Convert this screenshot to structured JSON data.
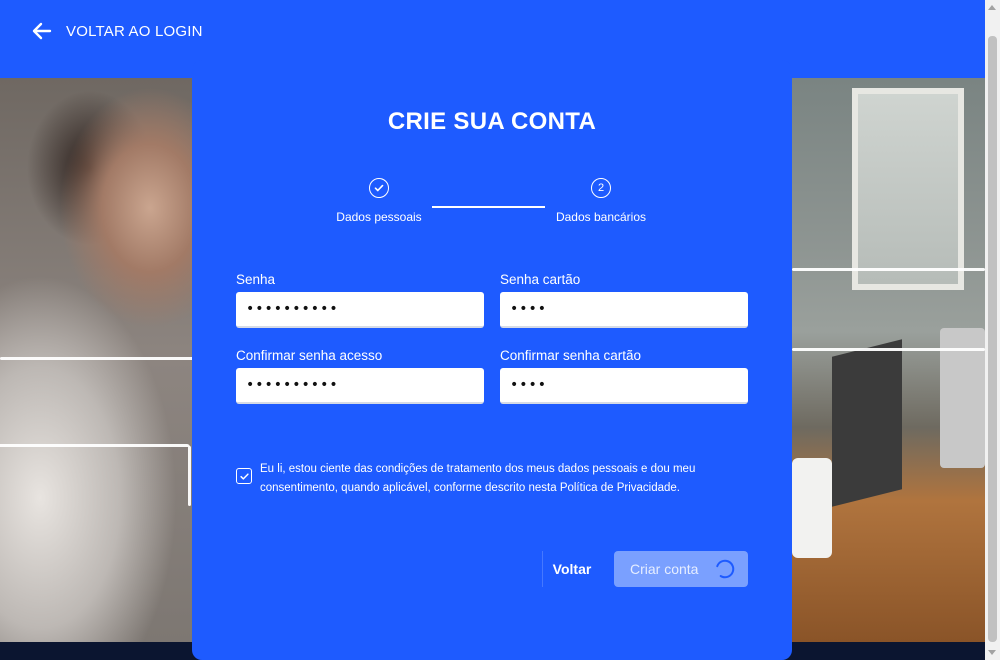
{
  "header": {
    "back_label": "VOLTAR AO LOGIN"
  },
  "card": {
    "title": "CRIE SUA CONTA",
    "steps": [
      {
        "label": "Dados pessoais",
        "state": "done",
        "icon": "check-icon"
      },
      {
        "label": "Dados bancários",
        "state": "current",
        "number": "2"
      }
    ],
    "fields": {
      "senha": {
        "label": "Senha",
        "value": "••••••••••"
      },
      "senha_cartao": {
        "label": "Senha cartão",
        "value": "••••"
      },
      "confirmar_senha_acesso": {
        "label": "Confirmar senha acesso",
        "value": "••••••••••"
      },
      "confirmar_senha_cartao": {
        "label": "Confirmar senha cartão",
        "value": "••••"
      }
    },
    "consent": {
      "checked": true,
      "text": "Eu li, estou ciente das condições de tratamento dos meus dados pessoais e dou meu consentimento, quando aplicável, conforme descrito nesta Política de Privacidade."
    },
    "buttons": {
      "back_label": "Voltar",
      "create_label": "Criar conta"
    }
  },
  "colors": {
    "primary": "#1e5bff",
    "button_disabled": "#7aa0ff",
    "dark": "#0b1530"
  }
}
